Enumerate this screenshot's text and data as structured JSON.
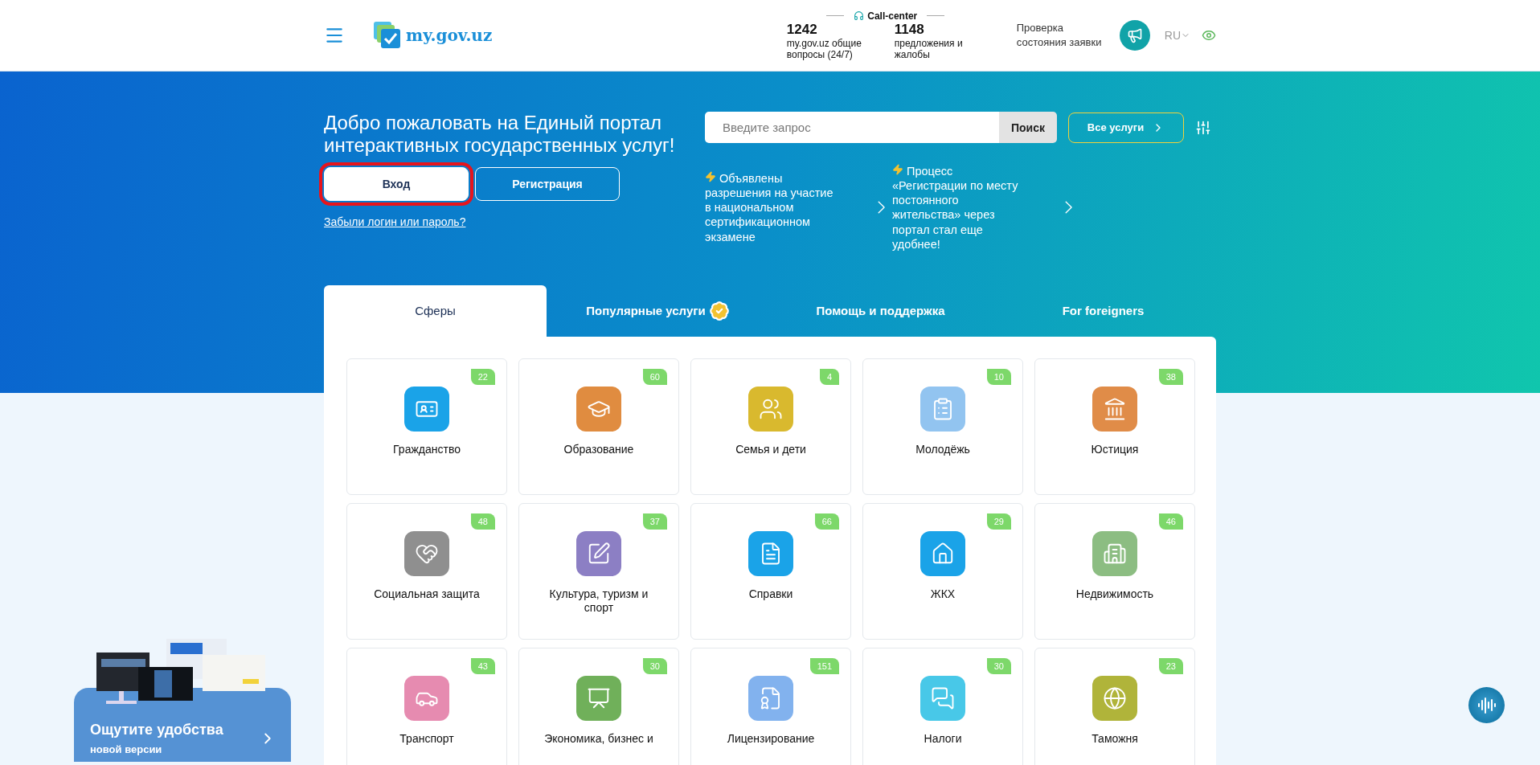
{
  "header": {
    "logo_text": "my.gov.uz",
    "call_center": {
      "title": "Call-center",
      "stats": [
        {
          "count": "1242",
          "label": "my.gov.uz общие вопросы (24/7)"
        },
        {
          "count": "1148",
          "label": "предложения и жалобы"
        }
      ]
    },
    "status_check": "Проверка состояния заявки",
    "language": "RU"
  },
  "hero": {
    "title": "Добро пожаловать на Единый портал интерактивных государственных услуг!",
    "auth_buttons": [
      {
        "label": "Вход",
        "kind": "primary",
        "highlighted": true
      },
      {
        "label": "Регистрация",
        "kind": "outline",
        "highlighted": false
      }
    ],
    "forgot_link": "Забыли логин или пароль?",
    "search": {
      "placeholder": "Введите запрос",
      "button": "Поиск"
    },
    "all_services": "Все услуги",
    "news": [
      "Объявлены разрешения на участие в национальном сертификационном экзамене",
      "Процесс «Регистрации по месту постоянного жительства» через портал стал еще удобнее!"
    ]
  },
  "tabs": [
    {
      "label": "Сферы",
      "selected": true
    },
    {
      "label": "Популярные услуги",
      "selected": false,
      "badge": true
    },
    {
      "label": "Помощь и поддержка",
      "selected": false
    },
    {
      "label": "For foreigners",
      "selected": false
    }
  ],
  "categories": [
    {
      "name": "Гражданство",
      "count": "22",
      "color": "#1aa3e8"
    },
    {
      "name": "Образование",
      "count": "60",
      "color": "#e08c40"
    },
    {
      "name": "Семья и дети",
      "count": "4",
      "color": "#d9b92e"
    },
    {
      "name": "Молодёжь",
      "count": "10",
      "color": "#92c4f0"
    },
    {
      "name": "Юстиция",
      "count": "38",
      "color": "#e08c48"
    },
    {
      "name": "Социальная защита",
      "count": "48",
      "color": "#8f8f8f"
    },
    {
      "name": "Культура, туризм и спорт",
      "count": "37",
      "color": "#8c7fc4"
    },
    {
      "name": "Справки",
      "count": "66",
      "color": "#1aa3e8"
    },
    {
      "name": "ЖКХ",
      "count": "29",
      "color": "#1aa3e8"
    },
    {
      "name": "Недвижимость",
      "count": "46",
      "color": "#8cbd82"
    },
    {
      "name": "Транспорт",
      "count": "43",
      "color": "#e68bb0"
    },
    {
      "name": "Экономика, бизнес и",
      "count": "30",
      "color": "#70b05a"
    },
    {
      "name": "Лицензирование",
      "count": "151",
      "color": "#82b2ee"
    },
    {
      "name": "Налоги",
      "count": "30",
      "color": "#48c8e8"
    },
    {
      "name": "Таможня",
      "count": "23",
      "color": "#b0b43a"
    }
  ],
  "promo": {
    "title": "Ощутите удобства",
    "subtitle": "новой версии"
  }
}
